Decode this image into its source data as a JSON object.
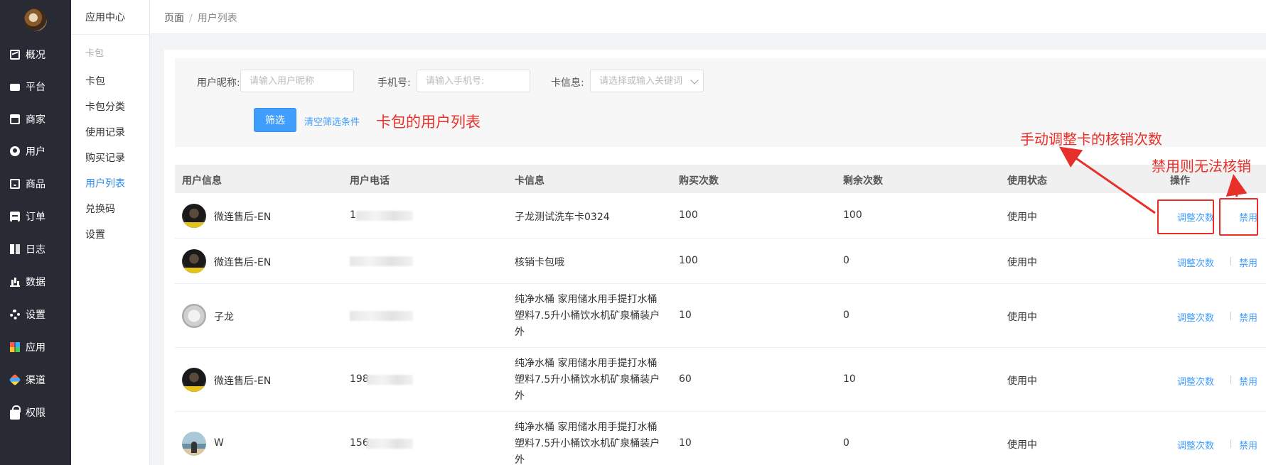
{
  "nav": {
    "items": [
      {
        "label": "概况",
        "icon": "monitor-chart-icon"
      },
      {
        "label": "平台",
        "icon": "monitor-icon"
      },
      {
        "label": "商家",
        "icon": "store-icon"
      },
      {
        "label": "用户",
        "icon": "user-icon"
      },
      {
        "label": "商品",
        "icon": "bag-icon"
      },
      {
        "label": "订单",
        "icon": "clipboard-icon"
      },
      {
        "label": "日志",
        "icon": "book-icon"
      },
      {
        "label": "数据",
        "icon": "bar-chart-icon"
      },
      {
        "label": "设置",
        "icon": "gear-icon"
      },
      {
        "label": "应用",
        "icon": "app-grid-icon"
      },
      {
        "label": "渠道",
        "icon": "cube-icon"
      },
      {
        "label": "权限",
        "icon": "lock-icon"
      }
    ]
  },
  "subnav": {
    "title": "应用中心",
    "group": "卡包",
    "items": [
      {
        "label": "卡包"
      },
      {
        "label": "卡包分类"
      },
      {
        "label": "使用记录"
      },
      {
        "label": "购买记录"
      },
      {
        "label": "用户列表",
        "active": true
      },
      {
        "label": "兑换码"
      },
      {
        "label": "设置"
      }
    ]
  },
  "breadcrumb": {
    "root": "页面",
    "sep": "/",
    "current": "用户列表"
  },
  "filter": {
    "nickname_label": "用户昵称:",
    "nickname_placeholder": "请输入用户昵称",
    "phone_label": "手机号:",
    "phone_placeholder": "请输入手机号:",
    "card_label": "卡信息:",
    "card_placeholder": "请选择或输入关键词",
    "submit_label": "筛选",
    "clear_label": "清空筛选条件"
  },
  "annotations": {
    "title": "卡包的用户列表",
    "adjust": "手动调整卡的核销次数",
    "disable": "禁用则无法核销"
  },
  "table": {
    "headers": [
      "用户信息",
      "用户电话",
      "卡信息",
      "购买次数",
      "剩余次数",
      "使用状态",
      "操作"
    ],
    "rows": [
      {
        "nickname": "微连售后-EN",
        "phone": "1",
        "card_lines": [
          "子龙测试洗车卡0324"
        ],
        "buy": "100",
        "remain": "100",
        "status": "使用中",
        "adjust": "调整次数",
        "disable": "禁用"
      },
      {
        "nickname": "微连售后-EN",
        "phone": "",
        "card_lines": [
          "核销卡包哦"
        ],
        "buy": "100",
        "remain": "0",
        "status": "使用中",
        "adjust": "调整次数",
        "disable": "禁用"
      },
      {
        "nickname": "子龙",
        "phone": "",
        "card_lines": [
          "纯净水桶 家用储水用手提打水桶",
          "塑料7.5升小桶饮水机矿泉桶装户",
          "外"
        ],
        "buy": "10",
        "remain": "0",
        "status": "使用中",
        "adjust": "调整次数",
        "disable": "禁用"
      },
      {
        "nickname": "微连售后-EN",
        "phone": "198",
        "card_lines": [
          "纯净水桶 家用储水用手提打水桶",
          "塑料7.5升小桶饮水机矿泉桶装户",
          "外"
        ],
        "buy": "60",
        "remain": "10",
        "status": "使用中",
        "adjust": "调整次数",
        "disable": "禁用"
      },
      {
        "nickname": "W",
        "phone": "156",
        "card_lines": [
          "纯净水桶 家用储水用手提打水桶",
          "塑料7.5升小桶饮水机矿泉桶装户",
          "外"
        ],
        "buy": "10",
        "remain": "0",
        "status": "使用中",
        "adjust": "调整次数",
        "disable": "禁用"
      }
    ]
  },
  "colors": {
    "primary": "#409eff",
    "annotation": "#e8302a",
    "sidebar": "#282b33"
  }
}
